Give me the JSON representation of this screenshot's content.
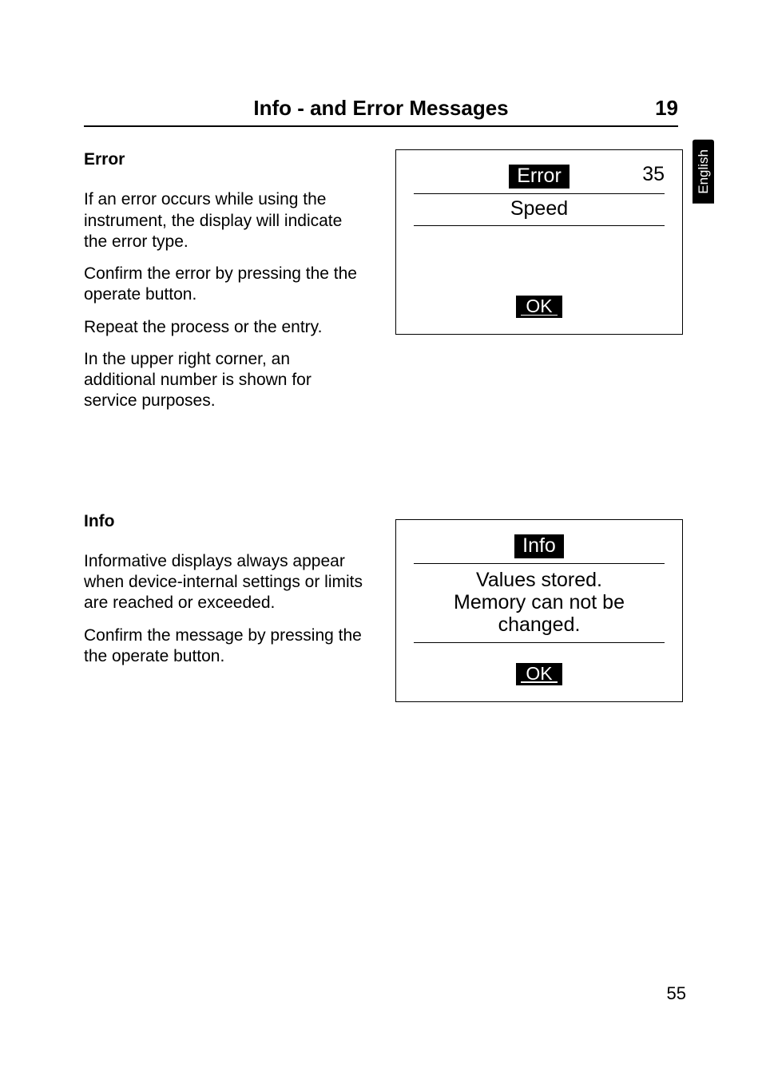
{
  "header": {
    "title": "Info - and Error Messages",
    "chapter_number": "19"
  },
  "side_tab": "English",
  "error_section": {
    "heading": "Error",
    "paragraphs": [
      "If an error occurs while using the instrument, the display will indicate the error type.",
      "Confirm the error by pressing the the operate button.",
      "Repeat the process or the entry.",
      "In the upper right corner, an additional number is shown for service purposes."
    ],
    "screen": {
      "title_badge": "Error",
      "corner_number": "35",
      "line2": "Speed",
      "ok_label": "OK"
    }
  },
  "info_section": {
    "heading": "Info",
    "paragraphs": [
      "Informative displays always appear when device-internal settings or limits are reached or exceeded.",
      "Confirm the message by pressing the the operate button."
    ],
    "screen": {
      "title_badge": "Info",
      "message_line1": "Values stored.",
      "message_line2": "Memory can not be",
      "message_line3": "changed.",
      "ok_label": "OK"
    }
  },
  "page_number": "55"
}
